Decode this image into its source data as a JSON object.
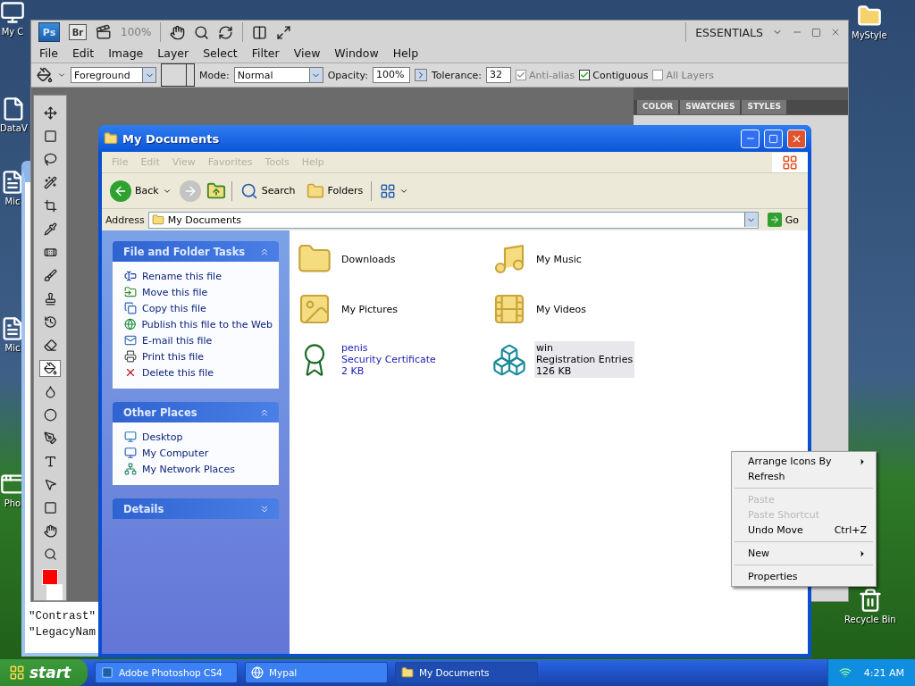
{
  "desktop_icons": [
    {
      "label": "My C",
      "kind": "computer"
    },
    {
      "label": "DataV",
      "kind": "file"
    },
    {
      "label": "Mic",
      "kind": "doc"
    },
    {
      "label": "Mic",
      "kind": "doc"
    },
    {
      "label": "Pho",
      "kind": "app"
    },
    {
      "label": "MyStyle",
      "kind": "folder"
    },
    {
      "label": "Recycle Bin",
      "kind": "recycle"
    }
  ],
  "back_window": {
    "lines": [
      "\"Contrast\"",
      "\"LegacyNam"
    ]
  },
  "photoshop": {
    "app_bar": {
      "logo": "Ps",
      "bridge": "Br",
      "zoom": "100%",
      "workspace": "ESSENTIALS"
    },
    "menu": [
      "File",
      "Edit",
      "Image",
      "Layer",
      "Select",
      "Filter",
      "View",
      "Window",
      "Help"
    ],
    "options_bar": {
      "fill_source": "Foreground",
      "mode_label": "Mode:",
      "mode": "Normal",
      "opacity_label": "Opacity:",
      "opacity": "100%",
      "tolerance_label": "Tolerance:",
      "tolerance": "32",
      "checkboxes": [
        {
          "label": "Anti-alias",
          "checked": true,
          "disabled": true
        },
        {
          "label": "Contiguous",
          "checked": true,
          "disabled": false
        },
        {
          "label": "All Layers",
          "checked": false,
          "disabled": true
        }
      ]
    },
    "panel_tabs": [
      "COLOR",
      "SWATCHES",
      "STYLES"
    ]
  },
  "explorer": {
    "title": "My Documents",
    "menu": [
      {
        "label": "File",
        "disabled": true
      },
      {
        "label": "Edit",
        "disabled": true
      },
      {
        "label": "View",
        "disabled": true
      },
      {
        "label": "Favorites",
        "disabled": true
      },
      {
        "label": "Tools",
        "disabled": true
      },
      {
        "label": "Help",
        "disabled": true
      }
    ],
    "toolbar": {
      "back": "Back",
      "search": "Search",
      "folders": "Folders"
    },
    "address": {
      "label": "Address",
      "value": "My Documents",
      "go": "Go"
    },
    "sections": [
      {
        "title": "File and Folder Tasks",
        "expanded": true,
        "items": [
          {
            "label": "Rename this file",
            "kind": "rename"
          },
          {
            "label": "Move this file",
            "kind": "move"
          },
          {
            "label": "Copy this file",
            "kind": "copy"
          },
          {
            "label": "Publish this file to the Web",
            "kind": "web"
          },
          {
            "label": "E-mail this file",
            "kind": "mail"
          },
          {
            "label": "Print this file",
            "kind": "print"
          },
          {
            "label": "Delete this file",
            "kind": "delete"
          }
        ]
      },
      {
        "title": "Other Places",
        "expanded": true,
        "items": [
          {
            "label": "Desktop",
            "kind": "desktop"
          },
          {
            "label": "My Computer",
            "kind": "computer"
          },
          {
            "label": "My Network Places",
            "kind": "network"
          }
        ]
      },
      {
        "title": "Details",
        "expanded": false
      }
    ],
    "files": [
      {
        "name": "Downloads",
        "kind": "folder",
        "selected": false,
        "highlighted": false
      },
      {
        "name": "My Music",
        "kind": "music",
        "selected": false,
        "highlighted": false
      },
      {
        "name": "My Pictures",
        "kind": "pictures",
        "selected": false,
        "highlighted": false
      },
      {
        "name": "My Videos",
        "kind": "videos",
        "selected": false,
        "highlighted": false
      },
      {
        "name": "penis",
        "type": "Security Certificate",
        "size": "2 KB",
        "kind": "certificate",
        "selected": false,
        "highlighted": true
      },
      {
        "name": "win",
        "type": "Registration Entries",
        "size": "126 KB",
        "kind": "registry",
        "selected": true,
        "highlighted": false
      }
    ]
  },
  "context_menu": [
    {
      "kind": "item",
      "label": "Arrange Icons By",
      "submenu": true,
      "disabled": false
    },
    {
      "kind": "item",
      "label": "Refresh",
      "submenu": false,
      "disabled": false
    },
    {
      "kind": "separator"
    },
    {
      "kind": "item",
      "label": "Paste",
      "submenu": false,
      "disabled": true
    },
    {
      "kind": "item",
      "label": "Paste Shortcut",
      "submenu": false,
      "disabled": true
    },
    {
      "kind": "item",
      "label": "Undo Move",
      "shortcut": "Ctrl+Z",
      "submenu": false,
      "disabled": false
    },
    {
      "kind": "separator"
    },
    {
      "kind": "item",
      "label": "New",
      "submenu": true,
      "disabled": false
    },
    {
      "kind": "separator"
    },
    {
      "kind": "item",
      "label": "Properties",
      "submenu": false,
      "disabled": false
    }
  ],
  "taskbar": {
    "start": "start",
    "tasks": [
      {
        "label": "Adobe Photoshop CS4",
        "kind": "photoshop",
        "selected": false
      },
      {
        "label": "Mypal",
        "kind": "browser",
        "selected": false
      },
      {
        "label": "My Documents",
        "kind": "folder",
        "selected": true
      }
    ],
    "clock": "4:21 AM"
  }
}
